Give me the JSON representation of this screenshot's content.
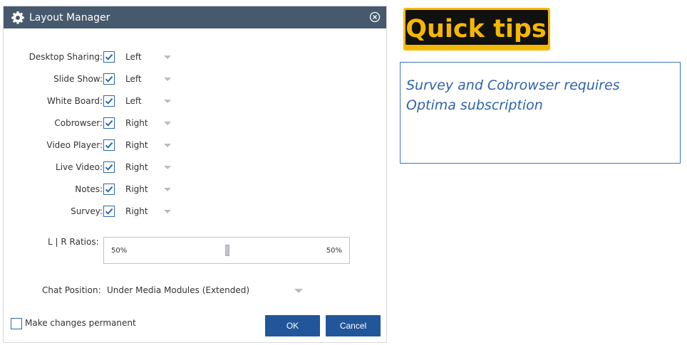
{
  "dialog": {
    "title": "Layout Manager",
    "rows": [
      {
        "label": "Desktop Sharing:",
        "checked": true,
        "value": "Left"
      },
      {
        "label": "Slide Show:",
        "checked": true,
        "value": "Left"
      },
      {
        "label": "White Board:",
        "checked": true,
        "value": "Left"
      },
      {
        "label": "Cobrowser:",
        "checked": true,
        "value": "Right"
      },
      {
        "label": "Video Player:",
        "checked": true,
        "value": "Right"
      },
      {
        "label": "Live Video:",
        "checked": true,
        "value": "Right"
      },
      {
        "label": "Notes:",
        "checked": true,
        "value": "Right"
      },
      {
        "label": "Survey:",
        "checked": true,
        "value": "Right"
      }
    ],
    "ratio": {
      "label": "L | R Ratios:",
      "left_value": "50%",
      "right_value": "50%",
      "split": 0.5
    },
    "chat": {
      "label": "Chat Position:",
      "value": "Under Media Modules (Extended)"
    },
    "permanent": {
      "label": "Make changes permanent",
      "checked": false
    },
    "buttons": {
      "ok": "OK",
      "cancel": "Cancel"
    }
  },
  "quick_tips": {
    "logo_text": "Quick tips",
    "tip_line1": "Survey and Cobrowser requires",
    "tip_line2": "Optima subscription"
  },
  "colors": {
    "titlebar": "#47596d",
    "button": "#21579a",
    "checkbox": "#2c6aa8",
    "tip_text": "#2e62ad",
    "logo_yellow": "#f5b800"
  },
  "icons": [
    "gear-icon",
    "close-icon",
    "checkmark-icon",
    "chevron-down-icon"
  ]
}
